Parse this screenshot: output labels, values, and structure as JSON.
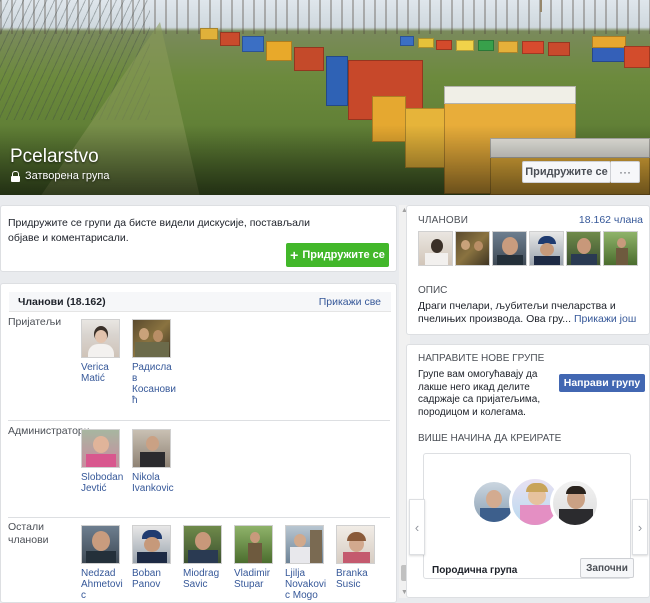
{
  "group": {
    "title": "Pcelarstvo",
    "privacy": "Затворена група",
    "join_label": "Придружите се",
    "more_label": "···"
  },
  "join_prompt": {
    "text": "Придружите се групи да бисте видели дискусије, постављали објаве и коментарисали.",
    "button_label": "Придружите се"
  },
  "members_panel": {
    "title": "Чланови (18.162)",
    "show_all": "Прикажи све",
    "sections": [
      {
        "label": "Пријатељи",
        "people": [
          "Verica Matić",
          "Радислав Косановић"
        ]
      },
      {
        "label": "Администратори",
        "people": [
          "Slobodan Jevtić",
          "Nikola Ivankovic"
        ]
      },
      {
        "label": "Остали чланови",
        "people": [
          "Nedzad Ahmetovic",
          "Boban Panov",
          "Miodrag Savic",
          "Vladimir Stupar",
          "Ljilja Novakovic Mogo",
          "Branka Susic"
        ]
      }
    ]
  },
  "right_members": {
    "title": "ЧЛАНОВИ",
    "count": "18.162 члана"
  },
  "description": {
    "title": "ОПИС",
    "text": "Драги пчелари, љубитељи пчеларства и пчелињих производа. Ова гру...",
    "more": "Прикажи још"
  },
  "create_group": {
    "title": "НАПРАВИТЕ НОВЕ ГРУПЕ",
    "text": "Групе вам омогућавају да лакше него икад делите садржаје са пријатељима, породицом и колегама.",
    "button_label": "Направи групу",
    "more_title": "ВИШЕ НАЧИНА ДА КРЕИРАТЕ",
    "card_label": "Породична група",
    "card_button": "Започни"
  },
  "colors": {
    "join_green": "#42b72a",
    "fb_blue": "#4267b2",
    "link_blue": "#365899"
  }
}
